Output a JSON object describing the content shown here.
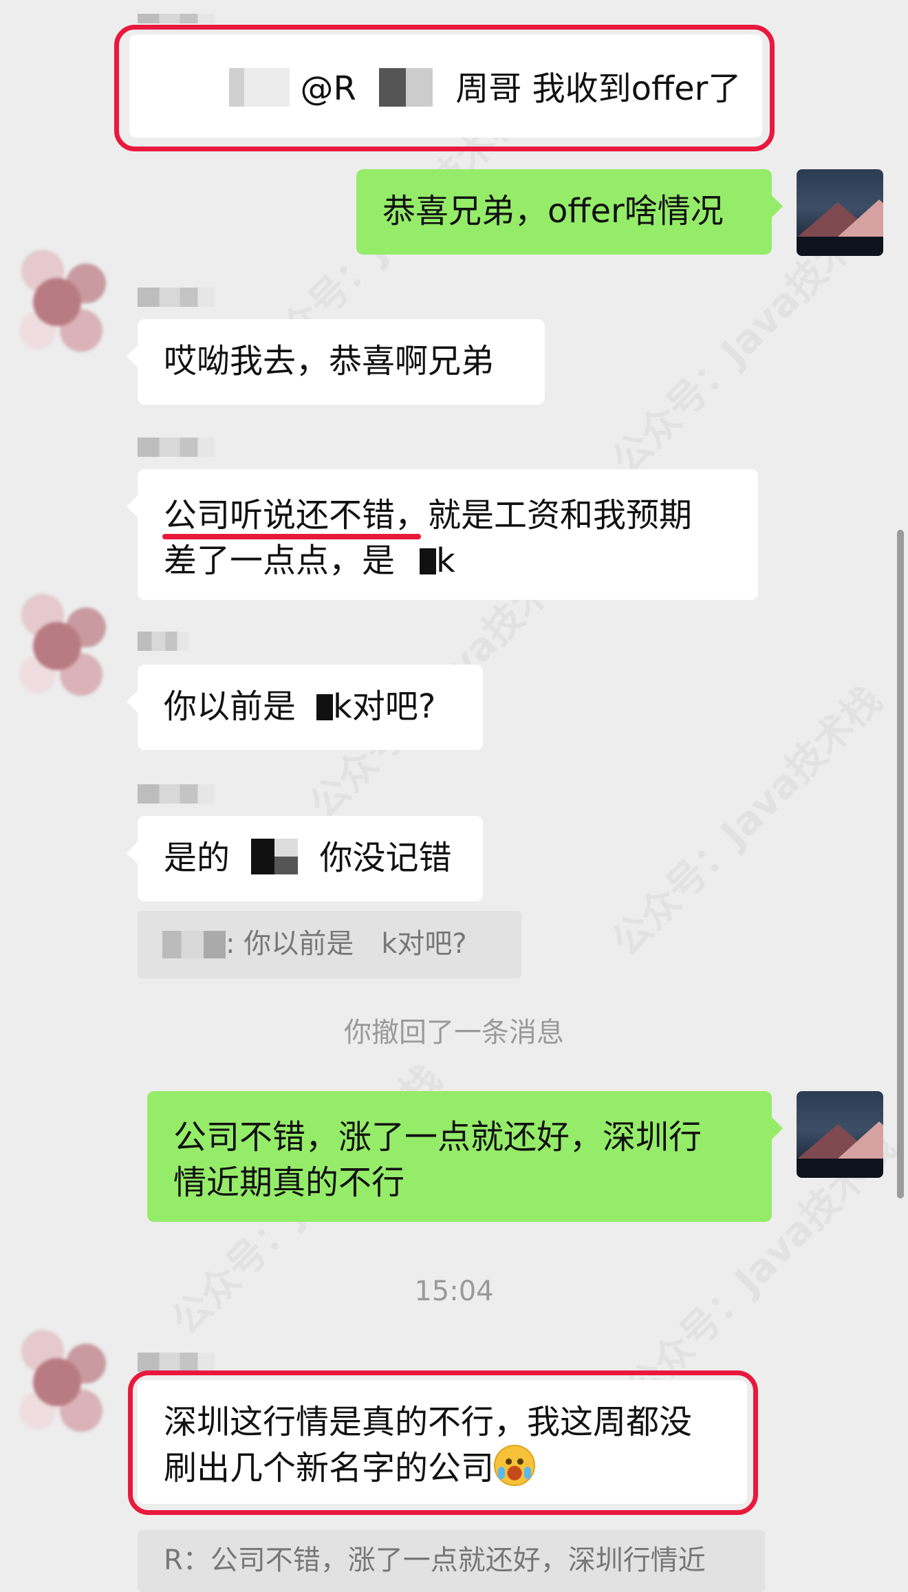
{
  "watermark": "公众号：Java技术栈",
  "messages": {
    "top_card": {
      "mention": "@R",
      "text": "周哥 我收到offer了"
    },
    "m1": "恭喜兄弟，offer啥情况",
    "m2": "哎呦我去，恭喜啊兄弟",
    "m3": {
      "line1_part1": "公司听说还不错",
      "line1_part2": "，就是工资和我预期",
      "line2_part1": "差了一点点，是",
      "line2_part2": "k"
    },
    "m4": {
      "part1": "你以前是",
      "part2": "k对吧?"
    },
    "m5": {
      "part1": "是的",
      "part2": "你没记错"
    },
    "quote1": {
      "sep": ":",
      "part1": "你以前是",
      "part2": "k对吧?"
    },
    "recall_notice": "你撤回了一条消息",
    "m6": {
      "line1": "公司不错，涨了一点就还好，深圳行",
      "line2": "情近期真的不行"
    },
    "timestamp": "15:04",
    "m7": {
      "line1": "深圳这行情是真的不行，我这周都没",
      "line2": "刷出几个新名字的公司"
    },
    "quote2": "R：公司不错，涨了一点就还好，深圳行情近"
  },
  "colors": {
    "background": "#ededed",
    "outgoing_bubble": "#95ec69",
    "incoming_bubble": "#ffffff",
    "highlight": "#e8193c"
  },
  "icons": {
    "emoji": "crying-laughing-emoji"
  }
}
